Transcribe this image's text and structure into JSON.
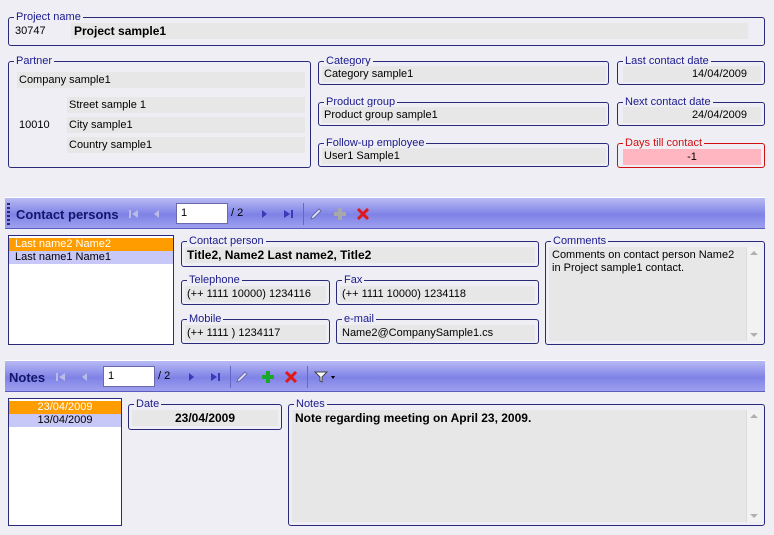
{
  "project": {
    "legend": "Project name",
    "id": "30747",
    "name": "Project sample1"
  },
  "partner": {
    "legend": "Partner",
    "company": "Company sample1",
    "street": "Street sample 1",
    "zip": "10010",
    "city": "City sample1",
    "country": "Country sample1"
  },
  "category": {
    "legend": "Category",
    "value": "Category sample1"
  },
  "product_group": {
    "legend": "Product group",
    "value": "Product group sample1"
  },
  "followup": {
    "legend": "Follow-up employee",
    "value": "User1 Sample1"
  },
  "last_contact": {
    "legend": "Last contact date",
    "value": "14/04/2009"
  },
  "next_contact": {
    "legend": "Next contact date",
    "value": "24/04/2009"
  },
  "days_till": {
    "legend": "Days till contact",
    "value": "-1"
  },
  "contacts_toolbar": {
    "title": "Contact persons",
    "page": "1",
    "total": "/ 2"
  },
  "contacts_list": [
    "Last name2 Name2",
    "Last name1 Name1"
  ],
  "contact_person": {
    "legend": "Contact person",
    "value": "Title2, Name2 Last name2, Title2"
  },
  "telephone": {
    "legend": "Telephone",
    "value": "(++ 1111 10000) 1234116"
  },
  "fax": {
    "legend": "Fax",
    "value": "(++ 1111 10000) 1234118"
  },
  "mobile": {
    "legend": "Mobile",
    "value": "(++ 1111 ) 1234117"
  },
  "email": {
    "legend": "e-mail",
    "value": "Name2@CompanySample1.cs"
  },
  "comments": {
    "legend": "Comments",
    "value": "Comments on contact person Name2 in Project sample1 contact."
  },
  "notes_toolbar": {
    "title": "Notes",
    "page": "1",
    "total": "/ 2"
  },
  "notes_list": [
    "23/04/2009",
    "13/04/2009"
  ],
  "note_date": {
    "legend": "Date",
    "value": "23/04/2009"
  },
  "note_text": {
    "legend": "Notes",
    "value": "Note regarding meeting on April 23, 2009."
  },
  "colors": {
    "accent_border": "#2a2a7a",
    "legend_text": "#1a1a8c",
    "selected_item": "#ff9c00",
    "days_till_border": "#d01010",
    "days_till_fill": "#ffb6c0"
  },
  "icons": [
    "first-icon",
    "prev-icon",
    "next-icon",
    "last-icon",
    "edit-icon",
    "add-icon",
    "delete-icon",
    "filter-icon"
  ]
}
